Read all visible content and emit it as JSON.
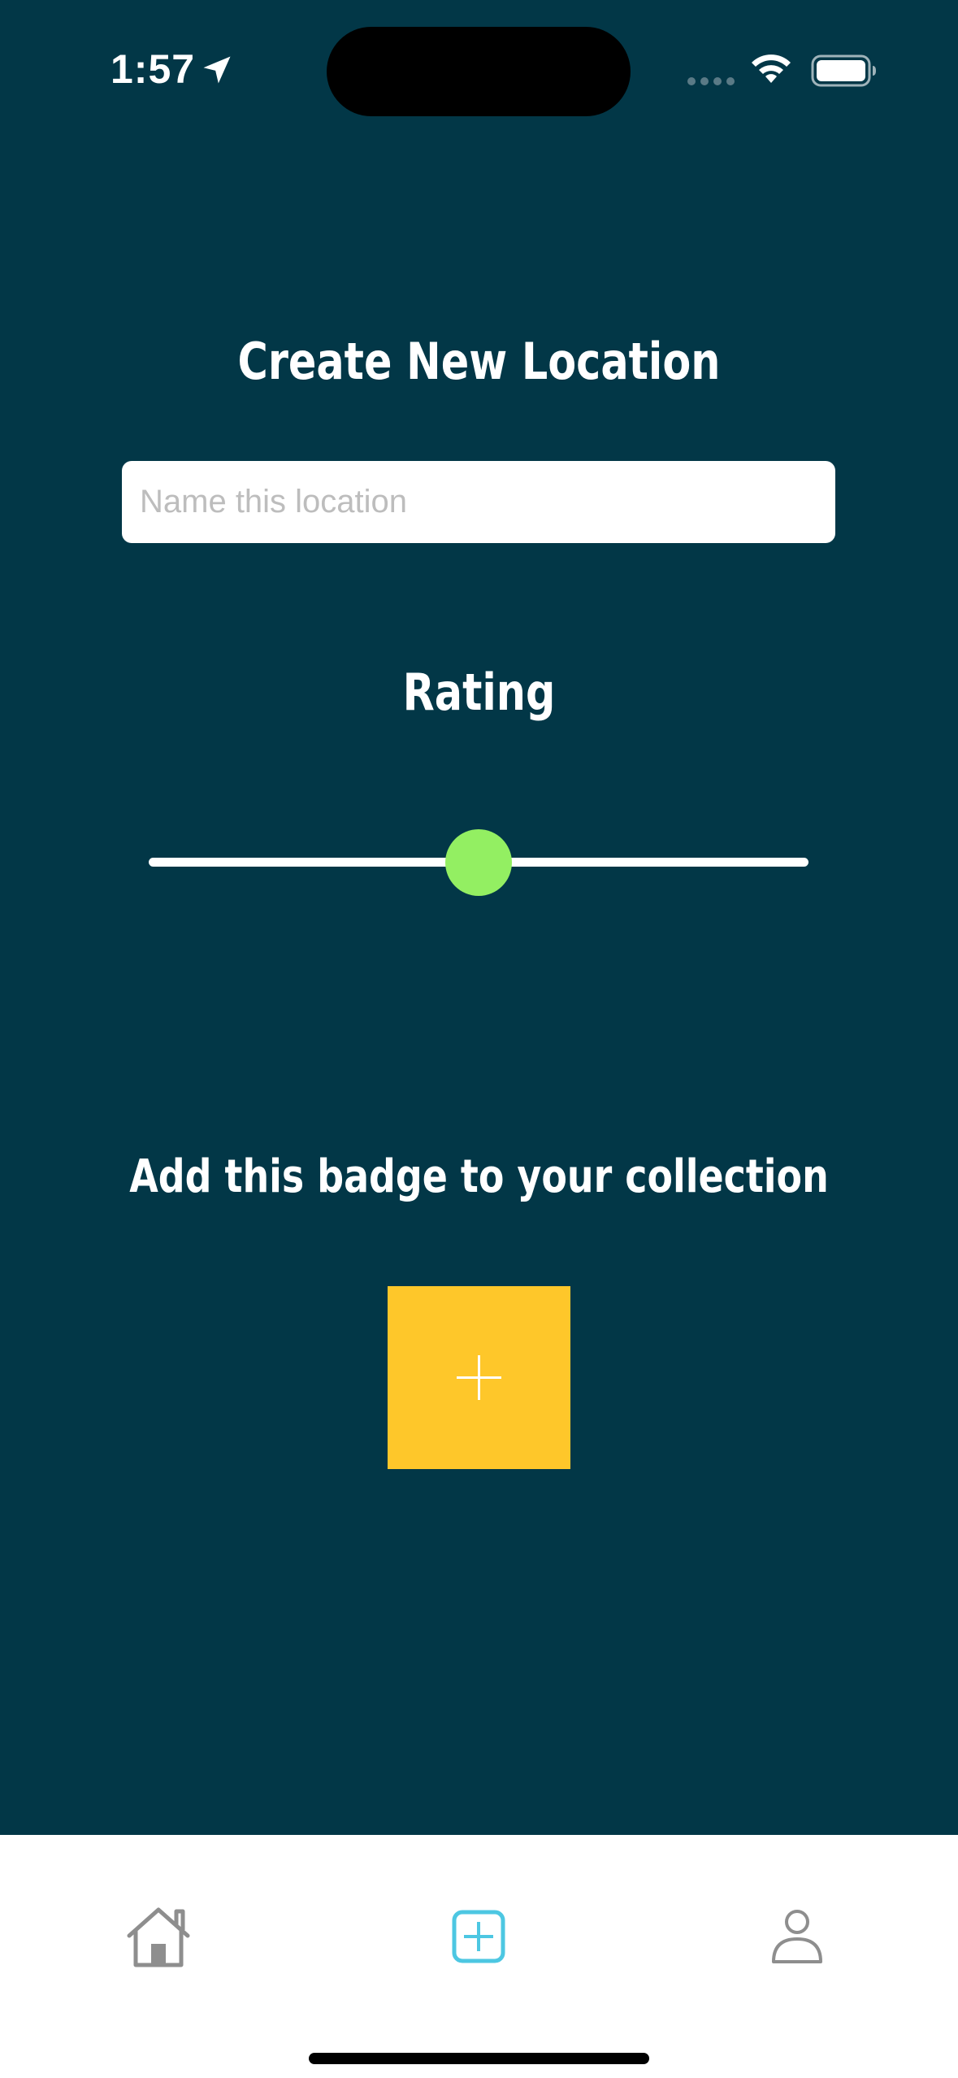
{
  "status_bar": {
    "time": "1:57",
    "icons": [
      "location-arrow-icon",
      "signal-dots-icon",
      "wifi-icon",
      "battery-icon"
    ]
  },
  "main": {
    "title": "Create New Location",
    "name_input": {
      "value": "",
      "placeholder": "Name this location"
    },
    "rating": {
      "label": "Rating",
      "slider_value_fraction": 0.5,
      "thumb_color": "#93ef62"
    },
    "badge": {
      "heading": "Add this badge to your collection",
      "button_icon": "plus-icon",
      "button_color": "#fec72a"
    }
  },
  "tab_bar": {
    "tabs": [
      {
        "icon": "home-icon",
        "active": false
      },
      {
        "icon": "add-square-icon",
        "active": true
      },
      {
        "icon": "profile-icon",
        "active": false
      }
    ],
    "active_color": "#4dc7e2",
    "inactive_color": "#8e8e8e"
  },
  "colors": {
    "background": "#023747",
    "accent_yellow": "#fec72a",
    "accent_green": "#93ef62"
  }
}
